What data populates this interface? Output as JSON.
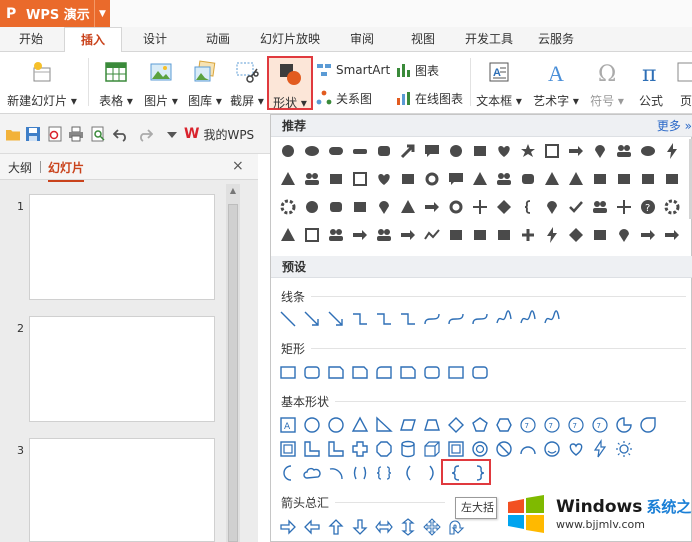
{
  "app": {
    "logo": "P",
    "title": "WPS 演示"
  },
  "tabs": [
    "开始",
    "插入",
    "设计",
    "动画",
    "幻灯片放映",
    "审阅",
    "视图",
    "开发工具",
    "云服务"
  ],
  "active_tab": "插入",
  "ribbon": {
    "new_slide": "新建幻灯片",
    "table": "表格",
    "picture": "图片",
    "gallery": "图库",
    "screenshot": "截屏",
    "shape": "形状",
    "smartart": "SmartArt",
    "chart": "图表",
    "relation": "关系图",
    "online_chart": "在线图表",
    "textbox": "文本框",
    "wordart": "艺术字",
    "symbol": "符号",
    "formula": "公式",
    "page_partial": "页"
  },
  "quick": {
    "mywps": "我的WPS"
  },
  "left_panel": {
    "tab_outline": "大纲",
    "tab_slides": "幻灯片",
    "close": "×",
    "slides": [
      "1",
      "2",
      "3"
    ]
  },
  "dropdown": {
    "recommended": "推荐",
    "more": "更多",
    "preset": "预设",
    "lines": "线条",
    "rectangles": "矩形",
    "basic_shapes": "基本形状",
    "arrows": "箭头总汇",
    "tooltip": "左大括"
  },
  "watermark": {
    "brand": "Windows",
    "brand_cn": "系统之家",
    "url": "www.bjjmlv.com"
  },
  "colors": {
    "accent": "#c9421b",
    "app_orange": "#ea6a2b",
    "highlight": "#e0393e",
    "icon_gray": "#4a4a4a",
    "icon_blue": "#2e6fb6"
  }
}
